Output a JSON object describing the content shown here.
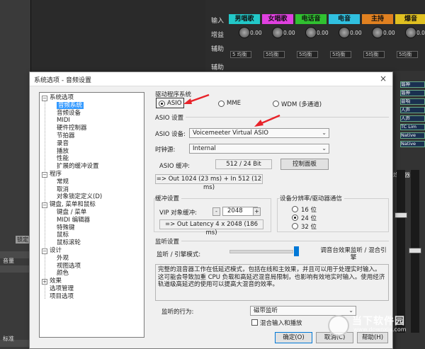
{
  "daw": {
    "left_labels": [
      "标准",
      "音量",
      "锁定"
    ],
    "mixer_labels": [
      "输入",
      "增益",
      "辅助",
      "辅助"
    ],
    "channels": [
      {
        "name": "男唱歌",
        "color": "#22c8c8"
      },
      {
        "name": "女唱歌",
        "color": "#e040e0"
      },
      {
        "name": "电话音",
        "color": "#30c030"
      },
      {
        "name": "电音",
        "color": "#30c0e0"
      },
      {
        "name": "主持",
        "color": "#e08020"
      },
      {
        "name": "爆音",
        "color": "#e0c020"
      }
    ],
    "knob_value": "0.00",
    "send_labels": [
      "5 均衡",
      "5均衡",
      "5均衡",
      "5均衡",
      "5均衡",
      "5均衡"
    ],
    "plugins": [
      "谐神",
      "谐神",
      "音响",
      "人声",
      "人声",
      "TC Lim",
      "Native",
      "Native"
    ],
    "right_label": "均衡器"
  },
  "dialog": {
    "title": "系统选项 - 音频设置",
    "close": "×",
    "tree": [
      {
        "label": "系统选项",
        "level": 0,
        "expander": "−"
      },
      {
        "label": "音频系统",
        "level": 1,
        "selected": true
      },
      {
        "label": "音频设备",
        "level": 1
      },
      {
        "label": "MIDI",
        "level": 1
      },
      {
        "label": "硬件控制器",
        "level": 1
      },
      {
        "label": "节拍器",
        "level": 1
      },
      {
        "label": "录音",
        "level": 1
      },
      {
        "label": "播放",
        "level": 1
      },
      {
        "label": "性能",
        "level": 1
      },
      {
        "label": "扩展的缓冲设置",
        "level": 1
      },
      {
        "label": "程序",
        "level": 0,
        "expander": "−"
      },
      {
        "label": "常规",
        "level": 1
      },
      {
        "label": "取消",
        "level": 1
      },
      {
        "label": "对象锁定定义(D)",
        "level": 1
      },
      {
        "label": "键盘, 菜单和鼠标",
        "level": 0,
        "expander": "−"
      },
      {
        "label": "键盘 / 菜单",
        "level": 1
      },
      {
        "label": "MIDI 编辑器",
        "level": 1
      },
      {
        "label": "特殊键",
        "level": 1
      },
      {
        "label": "鼠标",
        "level": 1
      },
      {
        "label": "鼠标滚轮",
        "level": 1
      },
      {
        "label": "设计",
        "level": 0,
        "expander": "−"
      },
      {
        "label": "外观",
        "level": 1
      },
      {
        "label": "视图选项",
        "level": 1
      },
      {
        "label": "颜色",
        "level": 1
      },
      {
        "label": "效果",
        "level": 0,
        "expander": "+"
      },
      {
        "label": "选项管理",
        "level": 0
      },
      {
        "label": "项目选项",
        "level": 0
      }
    ],
    "driver": {
      "title": "驱动程序系统",
      "options": [
        {
          "label": "ASIO",
          "checked": true
        },
        {
          "label": "MME",
          "checked": false
        },
        {
          "label": "WDM (多通道)",
          "checked": false
        }
      ]
    },
    "asio": {
      "title": "ASIO 设置",
      "device_label": "ASIO 设备:",
      "device_value": "Voicemeeter Virtual ASIO",
      "clock_label": "时钟源:",
      "clock_value": "Internal",
      "buffer_label": "ASIO 缓冲:",
      "buffer_value": "512 / 24 Bit",
      "control_panel": "控制面板",
      "latency": "=> Out 1024 (23 ms) + In 512 (12 ms)"
    },
    "buffer": {
      "title": "缓冲设置",
      "vip_label": "VIP 对象缓冲:",
      "minus": "-",
      "value": "2048",
      "plus": "+",
      "latency": "=> Out Latency 4 x 2048 (186 ms)"
    },
    "resolution": {
      "title": "设备分辨率/驱动器通信",
      "options": [
        {
          "label": "16 位",
          "checked": false
        },
        {
          "label": "24 位",
          "checked": true
        },
        {
          "label": "32 位",
          "checked": false
        }
      ]
    },
    "monitor": {
      "title": "监听设置",
      "engine_label": "监听 / 引擎模式:",
      "slider_level": 1.0,
      "slider_right_label": "调音台效果监听 / 混合引擎",
      "description": "完整的混音器工作在低延迟模式，包括在线和主效果，并且可以用于处理实时输入。这可能会导致加重 CPU 负载和高延迟混音局限制，也影响有效地实时输入。使用经济轨道级高延迟的使用可以提高大混音的效率。",
      "behavior_label": "监听的行为:",
      "behavior_value": "磁带监听",
      "mix_checkbox": "混合输入和播放"
    },
    "buttons": {
      "ok": "确定(O)",
      "cancel": "取消(C)",
      "help": "帮助(H)"
    }
  },
  "watermark": {
    "text": "当下软件园",
    "url": "www.downxia.com"
  },
  "colors": {
    "annotation_arrow": "#e8232a",
    "selection": "#3399ff",
    "slider": "#0078d7"
  }
}
